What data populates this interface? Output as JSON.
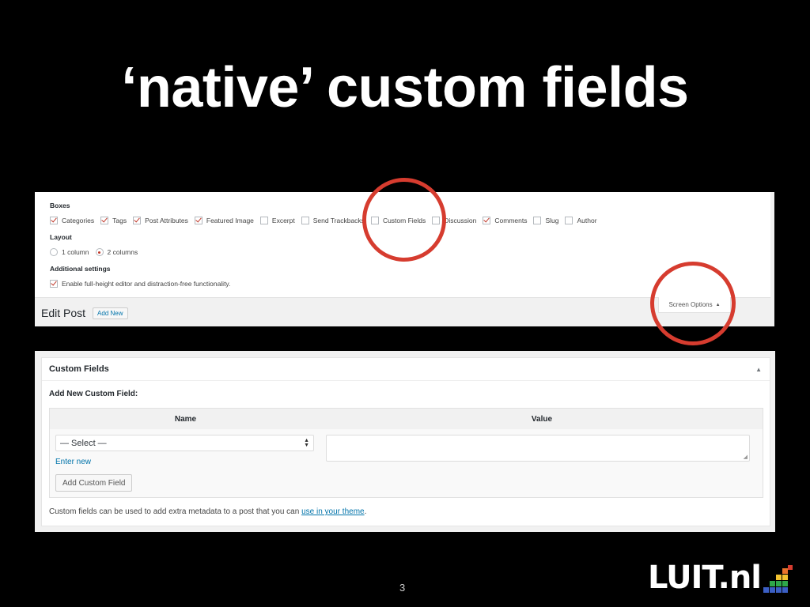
{
  "slide": {
    "title": "‘native’ custom fields",
    "page_number": "3",
    "logo_text": "LUIT.nl"
  },
  "screen_options": {
    "boxes_label": "Boxes",
    "boxes": [
      {
        "label": "Categories",
        "checked": true
      },
      {
        "label": "Tags",
        "checked": true
      },
      {
        "label": "Post Attributes",
        "checked": true
      },
      {
        "label": "Featured Image",
        "checked": true
      },
      {
        "label": "Excerpt",
        "checked": false
      },
      {
        "label": "Send Trackbacks",
        "checked": false
      },
      {
        "label": "Custom Fields",
        "checked": false
      },
      {
        "label": "Discussion",
        "checked": false
      },
      {
        "label": "Comments",
        "checked": true
      },
      {
        "label": "Slug",
        "checked": false
      },
      {
        "label": "Author",
        "checked": false
      }
    ],
    "layout_label": "Layout",
    "layout_options": [
      {
        "label": "1 column",
        "selected": false
      },
      {
        "label": "2 columns",
        "selected": true
      }
    ],
    "additional_label": "Additional settings",
    "additional_option": {
      "label": "Enable full-height editor and distraction-free functionality.",
      "checked": true
    },
    "toggle_label": "Screen Options"
  },
  "edit_post": {
    "title": "Edit Post",
    "add_new_label": "Add New"
  },
  "custom_fields": {
    "title": "Custom Fields",
    "add_new_label": "Add New Custom Field:",
    "col_name": "Name",
    "col_value": "Value",
    "select_value": "— Select —",
    "enter_new": "Enter new",
    "add_button": "Add Custom Field",
    "footnote_before": "Custom fields can be used to add extra metadata to a post that you can ",
    "footnote_link": "use in your theme",
    "footnote_after": "."
  },
  "colors": {
    "background": "#000000",
    "highlight_circle": "#d63c2f",
    "wp_link": "#0073aa"
  },
  "icons": {
    "screen_options_toggle": "triangle-up-icon",
    "metabox_toggle": "triangle-up-icon",
    "select_arrows": "updown-arrows-icon"
  }
}
